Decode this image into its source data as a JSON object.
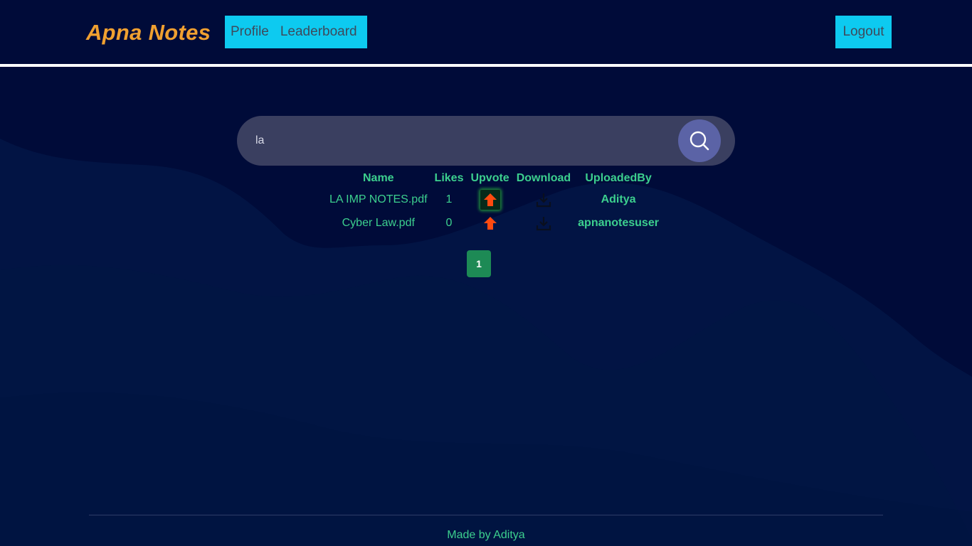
{
  "app": {
    "brand": "Apna Notes"
  },
  "nav": {
    "links": [
      {
        "label": "Profile"
      },
      {
        "label": "Leaderboard"
      }
    ],
    "logout_label": "Logout"
  },
  "search": {
    "value": "la",
    "placeholder": ""
  },
  "table": {
    "columns": [
      "Name",
      "Likes",
      "Upvote",
      "Download",
      "UploadedBy"
    ],
    "rows": [
      {
        "name": "LA IMP NOTES.pdf",
        "likes": "1",
        "upvoted": true,
        "uploaded_by": "Aditya"
      },
      {
        "name": "Cyber Law.pdf",
        "likes": "0",
        "upvoted": false,
        "uploaded_by": "apnanotesuser"
      }
    ]
  },
  "pagination": {
    "current": "1"
  },
  "footer": {
    "text": "Made by Aditya"
  },
  "colors": {
    "background": "#000b39",
    "brand": "#f0a030",
    "nav_button": "#0dcaf0",
    "accent_green": "#3ccf8e",
    "upvote_arrow": "#ff4a10",
    "pagination_bg": "#1d8a55"
  },
  "icons": {
    "search": "search-icon",
    "upvote": "arrow-up-icon",
    "download": "download-icon"
  }
}
